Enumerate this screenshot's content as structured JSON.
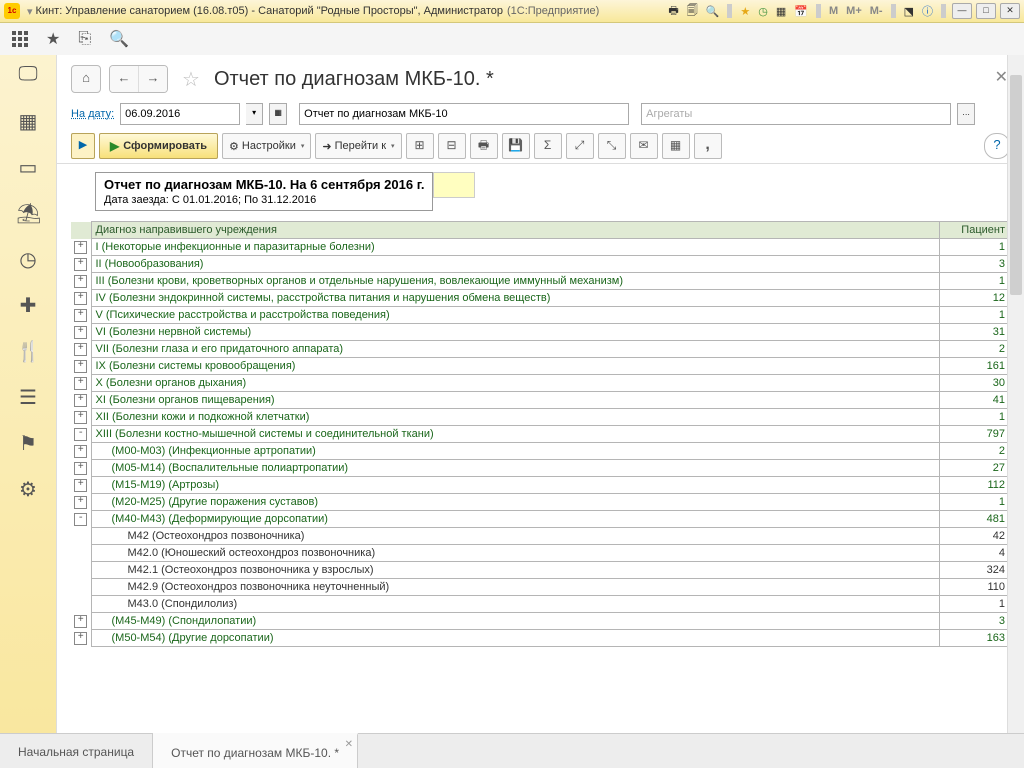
{
  "titlebar": {
    "app": "Кинт: Управление санаторием (16.08.т05) - Санаторий \"Родные Просторы\", Администратор",
    "platform": "(1С:Предприятие)",
    "m1": "M",
    "m2": "M+",
    "m3": "M-"
  },
  "page": {
    "title": "Отчет по диагнозам МКБ-10. *"
  },
  "filter": {
    "date_label": "На дату:",
    "date_value": "06.09.2016",
    "report_name": "Отчет по диагнозам МКБ-10",
    "aggregates_placeholder": "Агрегаты"
  },
  "actions": {
    "form": "Сформировать",
    "settings": "Настройки",
    "goto": "Перейти к"
  },
  "report": {
    "title": "Отчет по диагнозам МКБ-10. На 6 сентября 2016 г.",
    "subtitle": "Дата заезда: С 01.01.2016; По 31.12.2016",
    "col_diag": "Диагноз направившего учреждения",
    "col_pat": "Пациент"
  },
  "rows": [
    {
      "t": "+",
      "i": 0,
      "name": "I (Некоторые инфекционные и паразитарные болезни)",
      "v": "1"
    },
    {
      "t": "+",
      "i": 0,
      "name": "II (Новообразования)",
      "v": "3"
    },
    {
      "t": "+",
      "i": 0,
      "name": "III (Болезни крови, кроветворных органов и отдельные нарушения, вовлекающие иммунный механизм)",
      "v": "1"
    },
    {
      "t": "+",
      "i": 0,
      "name": "IV (Болезни эндокринной системы, расстройства питания и нарушения обмена веществ)",
      "v": "12"
    },
    {
      "t": "+",
      "i": 0,
      "name": "V (Психические расстройства и расстройства поведения)",
      "v": "1"
    },
    {
      "t": "+",
      "i": 0,
      "name": "VI (Болезни нервной системы)",
      "v": "31"
    },
    {
      "t": "+",
      "i": 0,
      "name": "VII (Болезни глаза и его придаточного аппарата)",
      "v": "2"
    },
    {
      "t": "+",
      "i": 0,
      "name": "IX (Болезни системы кровообращения)",
      "v": "161"
    },
    {
      "t": "+",
      "i": 0,
      "name": "X (Болезни органов дыхания)",
      "v": "30"
    },
    {
      "t": "+",
      "i": 0,
      "name": "XI (Болезни органов пищеварения)",
      "v": "41"
    },
    {
      "t": "+",
      "i": 0,
      "name": "XII (Болезни кожи и подкожной клетчатки)",
      "v": "1"
    },
    {
      "t": "-",
      "i": 0,
      "name": "XIII (Болезни костно-мышечной системы и соединительной ткани)",
      "v": "797"
    },
    {
      "t": "+",
      "i": 1,
      "name": "(M00-M03) (Инфекционные артропатии)",
      "v": "2"
    },
    {
      "t": "+",
      "i": 1,
      "name": "(M05-M14) (Воспалительные полиартропатии)",
      "v": "27"
    },
    {
      "t": "+",
      "i": 1,
      "name": "(M15-M19) (Артрозы)",
      "v": "112"
    },
    {
      "t": "+",
      "i": 1,
      "name": "(M20-M25) (Другие поражения суставов)",
      "v": "1"
    },
    {
      "t": "-",
      "i": 1,
      "name": "(M40-M43) (Деформирующие дорсопатии)",
      "v": "481"
    },
    {
      "t": "",
      "i": 2,
      "name": "M42 (Остеохондроз позвоночника)",
      "v": "42"
    },
    {
      "t": "",
      "i": 2,
      "name": "M42.0 (Юношеский остеохондроз позвоночника)",
      "v": "4"
    },
    {
      "t": "",
      "i": 2,
      "name": "M42.1 (Остеохондроз позвоночника у взрослых)",
      "v": "324"
    },
    {
      "t": "",
      "i": 2,
      "name": "M42.9 (Остеохондроз позвоночника неуточненный)",
      "v": "110"
    },
    {
      "t": "",
      "i": 2,
      "name": "M43.0 (Спондилолиз)",
      "v": "1"
    },
    {
      "t": "+",
      "i": 1,
      "name": "(M45-M49) (Спондилопатии)",
      "v": "3"
    },
    {
      "t": "+",
      "i": 1,
      "name": "(M50-M54) (Другие дорсопатии)",
      "v": "163"
    }
  ],
  "tabs": {
    "home": "Начальная страница",
    "report": "Отчет по диагнозам МКБ-10. *"
  }
}
